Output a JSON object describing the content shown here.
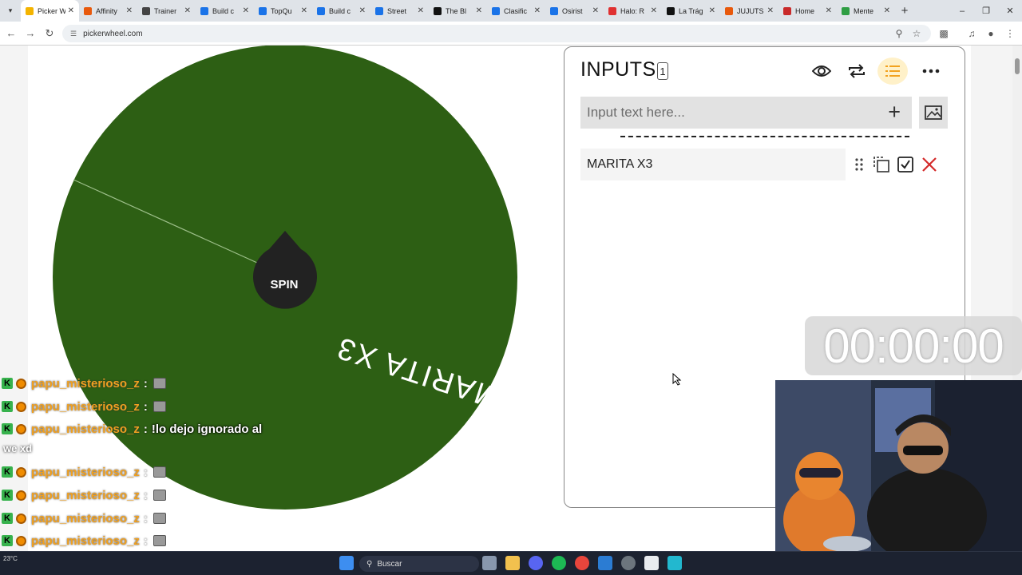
{
  "browser": {
    "tabs": [
      {
        "label": "Picker W",
        "color": "#f4b400",
        "active": true
      },
      {
        "label": "Affinity",
        "color": "#e8590c"
      },
      {
        "label": "Trainer",
        "color": "#444"
      },
      {
        "label": "Build c",
        "color": "#1a73e8"
      },
      {
        "label": "TopQu",
        "color": "#1a73e8"
      },
      {
        "label": "Build c",
        "color": "#1a73e8"
      },
      {
        "label": "Street",
        "color": "#1a73e8"
      },
      {
        "label": "The Bl",
        "color": "#111"
      },
      {
        "label": "Clasific",
        "color": "#1a73e8"
      },
      {
        "label": "Osirist",
        "color": "#1a73e8"
      },
      {
        "label": "Halo: R",
        "color": "#e03131"
      },
      {
        "label": "La Trág",
        "color": "#111"
      },
      {
        "label": "JUJUTS",
        "color": "#e8590c"
      },
      {
        "label": "Home",
        "color": "#c92a2a"
      },
      {
        "label": "Mente",
        "color": "#2f9e44"
      }
    ],
    "new_tab": "+",
    "address": "pickerwheel.com"
  },
  "wheel": {
    "entry_text": "MARITA X3",
    "spin_label": "SPIN",
    "color": "#2d5f14"
  },
  "inputs_panel": {
    "title": "INPUTS",
    "count": "1",
    "input_placeholder": "Input text here...",
    "entries": [
      {
        "text": "MARITA X3"
      }
    ],
    "icons": {
      "view": "eye-icon",
      "shuffle": "repeat-icon",
      "list": "list-icon",
      "more": "more-icon",
      "add": "plus-icon",
      "image": "image-icon"
    }
  },
  "timer": {
    "value": "00:00:00"
  },
  "chat": {
    "lines": [
      {
        "user": "papu_misterioso_z",
        "text": ""
      },
      {
        "user": "papu_misterioso_z",
        "text": ""
      },
      {
        "user": "papu_misterioso_z",
        "text": "!lo dejo ignorado al"
      },
      {
        "user": "papu_misterioso_z",
        "text": ""
      },
      {
        "user": "papu_misterioso_z",
        "text": ""
      },
      {
        "user": "papu_misterioso_z",
        "text": ""
      },
      {
        "user": "papu_misterioso_z",
        "text": ""
      },
      {
        "user": "papu_misterioso_z",
        "text": ""
      }
    ],
    "wrap_text": "we xd"
  },
  "taskbar": {
    "search_label": "Buscar",
    "weather": "23°C"
  },
  "colors": {
    "wheel_green": "#2d5f14",
    "accent_yellow": "#f7c948",
    "delete_red": "#d42a2a"
  }
}
